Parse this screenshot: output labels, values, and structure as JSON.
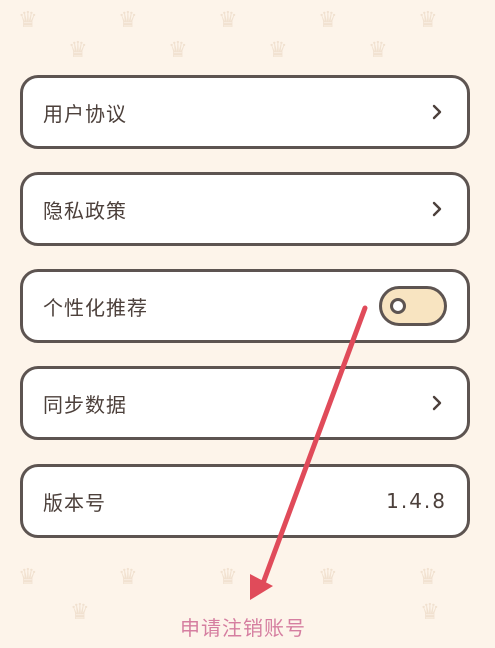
{
  "items": [
    {
      "label": "用户协议",
      "icon": "chevron-right-icon"
    },
    {
      "label": "隐私政策",
      "icon": "chevron-right-icon"
    },
    {
      "label": "个性化推荐",
      "toggle": {
        "state": "off"
      }
    },
    {
      "label": "同步数据",
      "icon": "chevron-right-icon"
    },
    {
      "label": "版本号",
      "value": "1.4.8"
    }
  ],
  "cancel_account": {
    "label": "申请注销账号",
    "color": "#d57ea0"
  },
  "colors": {
    "background": "#fdf4ea",
    "card_border": "#5d5451",
    "toggle_fill": "#f8e4c1",
    "annotation_arrow": "#e04b5a"
  }
}
